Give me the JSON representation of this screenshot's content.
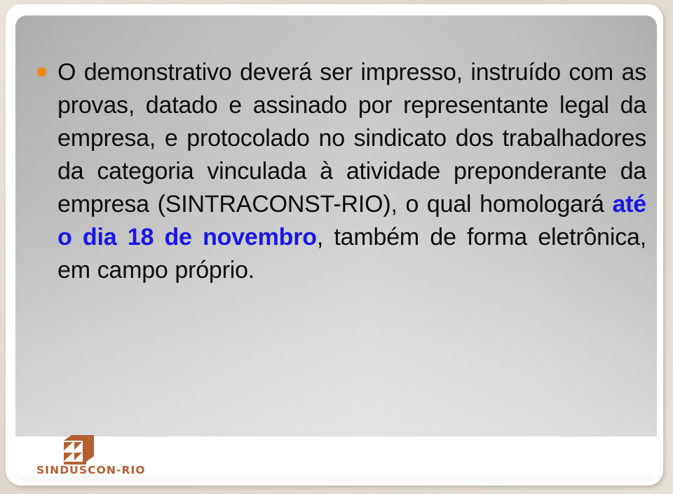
{
  "slide": {
    "bullet_icon": "orange-dot-bullet",
    "paragraph": {
      "segment_1": "O demonstrativo deverá ser impresso, instruído com as provas, datado e assinado por representante legal da empresa, e protocolado no sindicato dos trabalhadores da categoria vinculada à atividade preponderante da empresa (SINTRACONST-RIO), o qual homologará ",
      "highlight": "até o dia 18 de novembro",
      "segment_2": ", também de forma eletrônica, em campo próprio."
    },
    "colors": {
      "highlight_text": "#1a16e8",
      "bullet": "#f0890c",
      "body_text": "#0d0d0d",
      "logo": "#b45f32",
      "panel_gray": "#bdbdbd",
      "page_background": "#e5e0d6"
    }
  },
  "footer": {
    "logo": {
      "name": "SINDUSCON-RIO",
      "mark_icon": "siduscon-cube-icon"
    }
  }
}
